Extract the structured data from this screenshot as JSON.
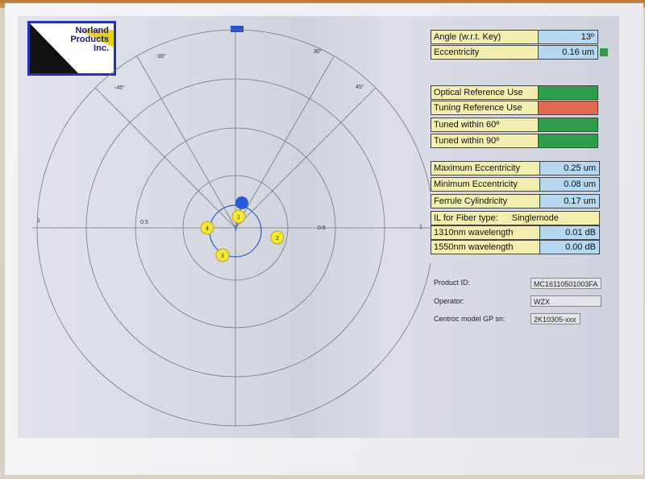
{
  "logo": {
    "text_line1": "Norland",
    "text_line2": "Products",
    "text_line3": "Inc."
  },
  "polar": {
    "ticks": {
      "left_outer": "1",
      "left_mid": "0.5",
      "right_mid": "0.5",
      "right_outer": "1",
      "neg30": "-30°",
      "pos30": "30°",
      "neg45": "-45°",
      "pos45": "45°"
    },
    "sensors": [
      "1",
      "2",
      "3",
      "4"
    ]
  },
  "measurements": {
    "angle_label": "Angle (w.r.t. Key)",
    "angle_value": "13º",
    "ecc_label": "Eccentricity",
    "ecc_value": "0.16 um"
  },
  "status": {
    "optical_ref": "Optical Reference Use",
    "tuning_ref": "Tuning Reference Use",
    "tuned60": "Tuned within 60º",
    "tuned90": "Tuned within 90º",
    "colors": {
      "optical_ref": "#2e9e4c",
      "tuning_ref": "#e06a52",
      "tuned60": "#2e9e4c",
      "tuned90": "#2e9e4c"
    }
  },
  "stats": {
    "max_ecc_label": "Maximum Eccentricity",
    "max_ecc_value": "0.25 um",
    "min_ecc_label": "Minimum Eccentricity",
    "min_ecc_value": "0.08 um",
    "ferrule_label": "Ferrule Cylindricity",
    "ferrule_value": "0.17 um",
    "il_label": "IL for Fiber type:",
    "il_type": "Singlemode",
    "wl1310_label": "1310nm wavelength",
    "wl1310_value": "0.01 dB",
    "wl1550_label": "1550nm wavelength",
    "wl1550_value": "0.00 dB"
  },
  "info": {
    "product_label": "Product ID:",
    "product_value": "MC16110501003FA",
    "operator_label": "Operator:",
    "operator_value": "WZX",
    "model_label": "Centroc model GP sn:",
    "model_value": "2K10305-xxx"
  }
}
